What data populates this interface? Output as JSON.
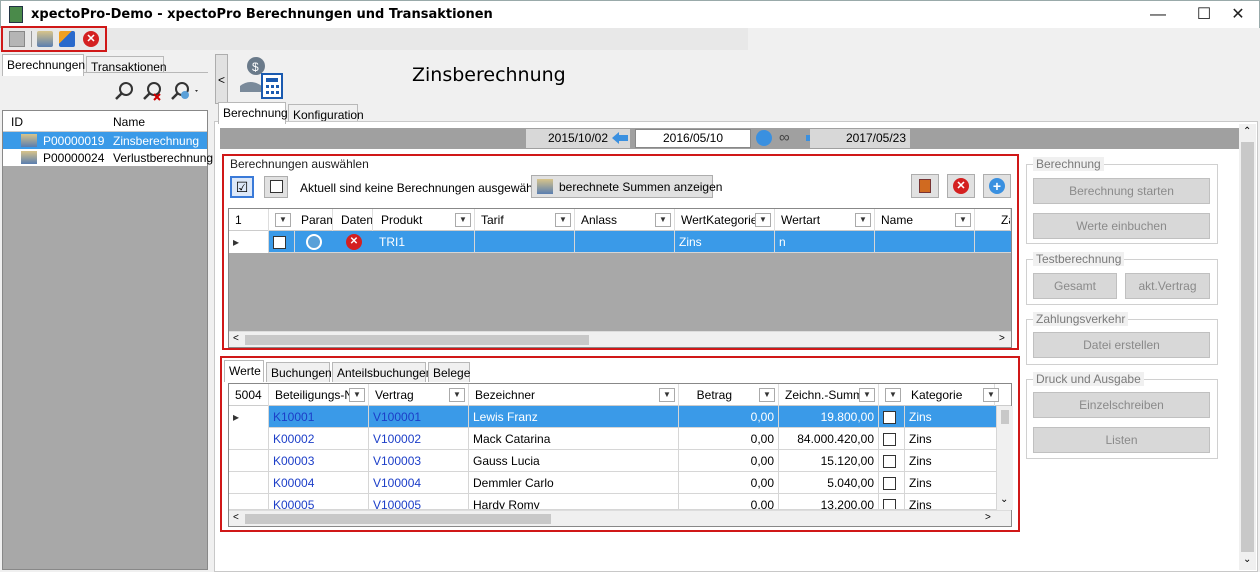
{
  "window": {
    "title": "xpectoPro-Demo - xpectoPro Berechnungen und Transaktionen",
    "minimize": "—",
    "maximize": "☐",
    "close": "✕"
  },
  "left_tabs": [
    "Berechnungen",
    "Transaktionen"
  ],
  "left_list": {
    "columns": [
      "ID",
      "Name"
    ],
    "rows": [
      {
        "id": "P00000019",
        "name": "Zinsberechnung"
      },
      {
        "id": "P00000024",
        "name": "Verlustberechnung"
      }
    ]
  },
  "main": {
    "collapse": "<",
    "heading": "Zinsberechnung",
    "tabs": [
      "Berechnung",
      "Konfiguration"
    ],
    "dates": {
      "start": "2015/10/02",
      "current": "2016/05/10",
      "end": "2017/05/23",
      "infinity": "∞"
    },
    "selection_group": {
      "label": "Berechnungen auswählen",
      "status": "Aktuell sind keine Berechnungen ausgewählt",
      "show_sums": "berechnete Summen anzeigen"
    },
    "upper_grid": {
      "count": "1",
      "columns": [
        "Param",
        "Daten",
        "Produkt",
        "Tarif",
        "Anlass",
        "WertKategorie",
        "Wertart",
        "Name",
        "Za"
      ],
      "row": {
        "produkt": "TRI1",
        "wertkategorie": "Zins",
        "wertart": "n"
      }
    },
    "lower_tabs": [
      "Werte",
      "Buchungen",
      "Anteilsbuchungen",
      "Belege"
    ],
    "lower_grid": {
      "count": "5004",
      "columns": [
        "Beteiligungs-Nr",
        "Vertrag",
        "Bezeichner",
        "Betrag",
        "Zeichn.-Summe",
        "Kategorie"
      ],
      "rows": [
        {
          "nr": "K10001",
          "vertrag": "V100001",
          "bez": "Lewis Franz",
          "betrag": "0,00",
          "summe": "19.800,00",
          "kat": "Zins"
        },
        {
          "nr": "K00002",
          "vertrag": "V100002",
          "bez": "Mack Catarina",
          "betrag": "0,00",
          "summe": "84.000.420,00",
          "kat": "Zins"
        },
        {
          "nr": "K00003",
          "vertrag": "V100003",
          "bez": "Gauss Lucia",
          "betrag": "0,00",
          "summe": "15.120,00",
          "kat": "Zins"
        },
        {
          "nr": "K00004",
          "vertrag": "V100004",
          "bez": "Demmler Carlo",
          "betrag": "0,00",
          "summe": "5.040,00",
          "kat": "Zins"
        },
        {
          "nr": "K00005",
          "vertrag": "V100005",
          "bez": "Hardy Romy",
          "betrag": "0,00",
          "summe": "13.200,00",
          "kat": "Zins"
        }
      ]
    }
  },
  "right_panel": {
    "berechnung": {
      "label": "Berechnung",
      "start": "Berechnung starten",
      "book": "Werte einbuchen"
    },
    "test": {
      "label": "Testberechnung",
      "total": "Gesamt",
      "current": "akt.Vertrag"
    },
    "payment": {
      "label": "Zahlungsverkehr",
      "create": "Datei erstellen"
    },
    "print": {
      "label": "Druck und Ausgabe",
      "single": "Einzelschreiben",
      "lists": "Listen"
    }
  }
}
